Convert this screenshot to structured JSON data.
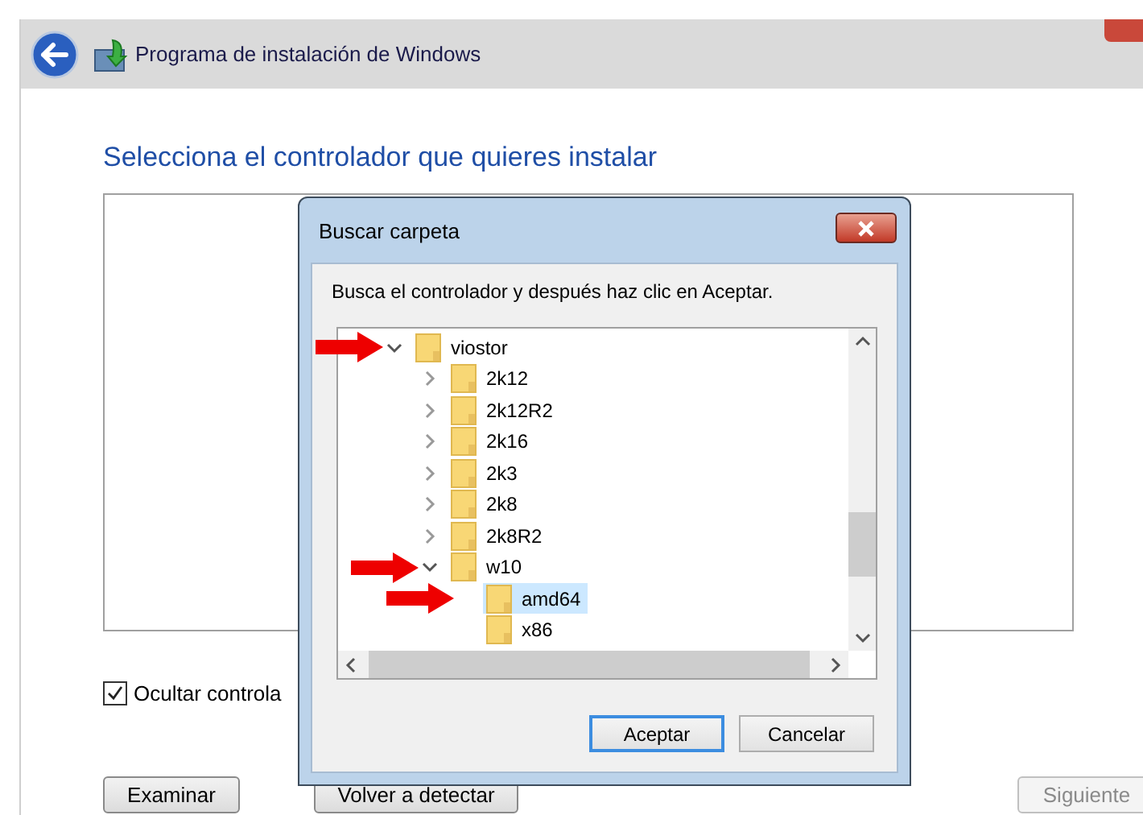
{
  "window": {
    "title": "Programa de instalación de Windows"
  },
  "heading": "Selecciona el controlador que quieres instalar",
  "hide_checkbox": {
    "label": "Ocultar controla",
    "checked": true
  },
  "buttons": [
    {
      "label": "Examinar",
      "disabled": false
    },
    {
      "label": "Volver a detectar",
      "disabled": false
    },
    {
      "label": "Siguiente",
      "disabled": true
    }
  ],
  "dialog": {
    "title": "Buscar carpeta",
    "instruction": "Busca el controlador y después haz clic en Aceptar.",
    "tree": [
      {
        "label": "viostor",
        "expanded": true,
        "selected": false,
        "marked": true,
        "children": [
          {
            "label": "2k12",
            "expanded": false,
            "selected": false,
            "marked": false
          },
          {
            "label": "2k12R2",
            "expanded": false,
            "selected": false,
            "marked": false
          },
          {
            "label": "2k16",
            "expanded": false,
            "selected": false,
            "marked": false
          },
          {
            "label": "2k3",
            "expanded": false,
            "selected": false,
            "marked": false
          },
          {
            "label": "2k8",
            "expanded": false,
            "selected": false,
            "marked": false
          },
          {
            "label": "2k8R2",
            "expanded": false,
            "selected": false,
            "marked": false
          },
          {
            "label": "w10",
            "expanded": true,
            "selected": false,
            "marked": true,
            "children": [
              {
                "label": "amd64",
                "selected": true,
                "marked": true
              },
              {
                "label": "x86",
                "selected": false,
                "marked": false
              }
            ]
          }
        ]
      }
    ],
    "buttons": [
      {
        "label": "Aceptar",
        "default": true
      },
      {
        "label": "Cancelar",
        "default": false
      }
    ]
  }
}
